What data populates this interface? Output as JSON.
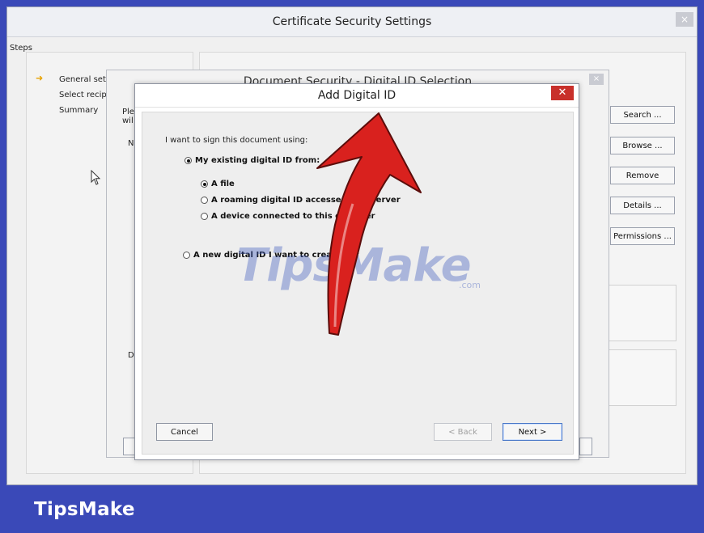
{
  "outer_window": {
    "title": "Certificate Security Settings",
    "close_glyph": "×",
    "steps_label": "Steps",
    "steps": [
      "General set",
      "Select recip",
      "Summary"
    ],
    "side_buttons": [
      "Search ...",
      "Browse ...",
      "Remove",
      "Details ...",
      "Permissions ..."
    ]
  },
  "middle_window": {
    "title": "Document Security - Digital ID Selection",
    "close_glyph": "×",
    "fragments": [
      "Ple",
      "wil",
      "N",
      "D"
    ]
  },
  "dialog": {
    "title": "Add Digital ID",
    "close_glyph": "✕",
    "prompt": "I want to sign this document using:",
    "options": {
      "existing": "My existing digital ID from:",
      "file": "A file",
      "roaming": "A roaming digital ID accessed",
      "roaming_tail": "server",
      "device": "A device connected to this co",
      "device_tail": "ter",
      "new": "A new digital ID I want to creat",
      "new_tail": "ter"
    },
    "selected": [
      "existing",
      "file"
    ],
    "buttons": {
      "cancel": "Cancel",
      "back": "< Back",
      "next": "Next >"
    }
  },
  "watermark": {
    "main": "TipsMake",
    "suffix": ".com"
  },
  "banner": {
    "text": "TipsMake"
  },
  "colors": {
    "banner_blue": "#3a49b8",
    "arrow_red": "#d9211e",
    "close_red": "#c8302b"
  },
  "icons": [
    "cursor-icon",
    "red-arrow-annotation",
    "step-arrow-icon"
  ]
}
